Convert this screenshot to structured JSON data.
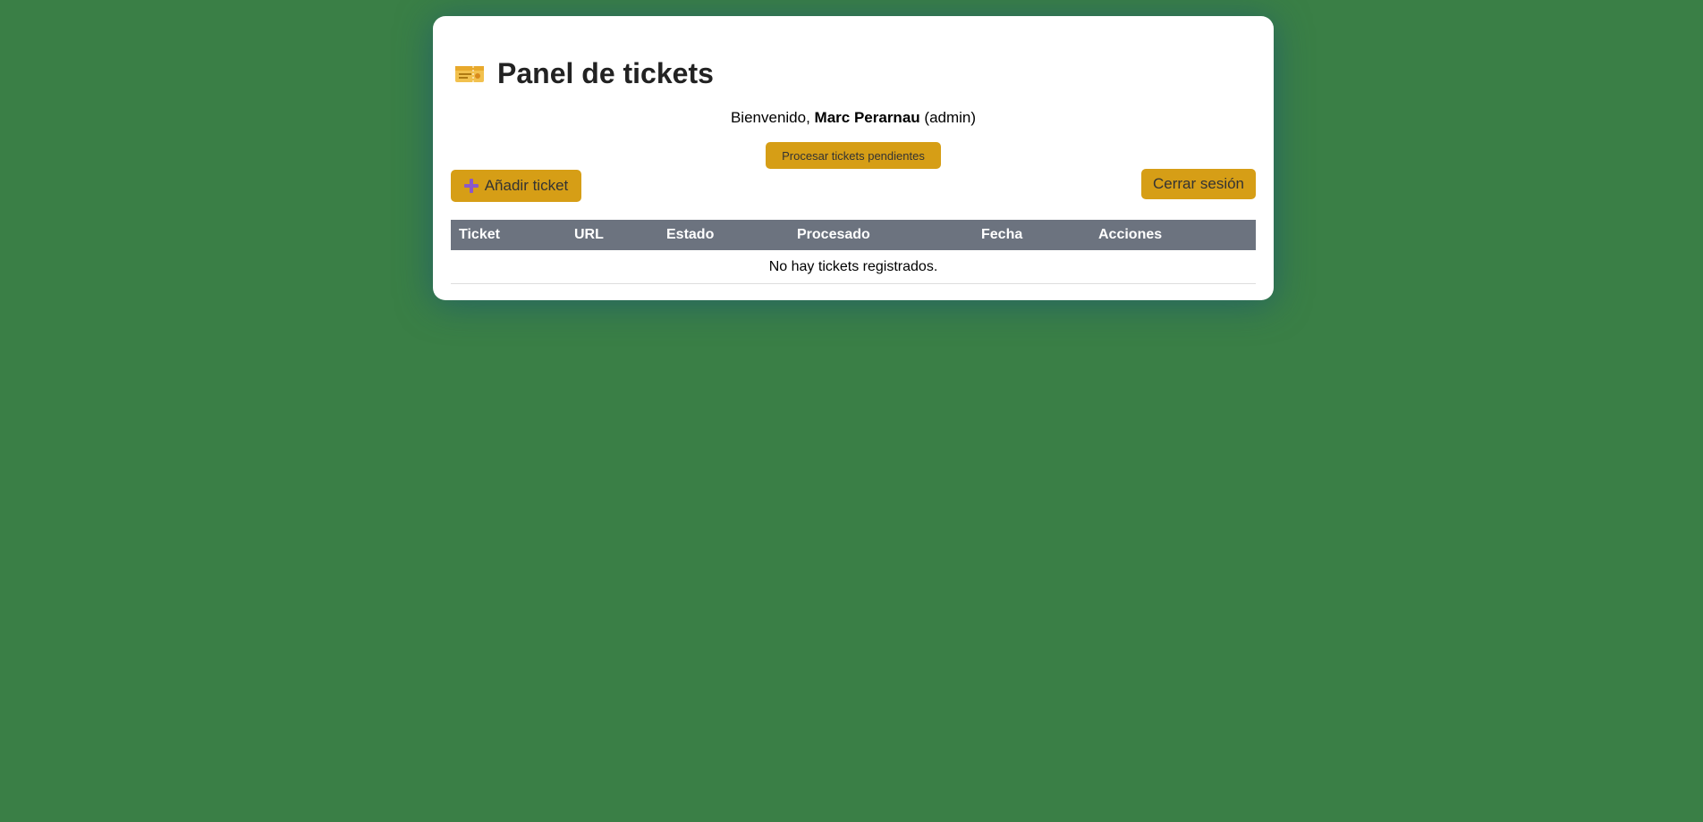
{
  "header": {
    "title": "Panel de tickets",
    "icon": "ticket-icon"
  },
  "welcome": {
    "prefix": "Bienvenido,",
    "user_name": "Marc Perarnau",
    "role": "(admin)"
  },
  "actions": {
    "process_label": "Procesar tickets pendientes",
    "add_label": "Añadir ticket",
    "add_icon": "plus-icon",
    "logout_label": "Cerrar sesión"
  },
  "table": {
    "columns": [
      "Ticket",
      "URL",
      "Estado",
      "Procesado",
      "Fecha",
      "Acciones"
    ],
    "empty_message": "No hay tickets registrados."
  },
  "colors": {
    "background": "#3a7f46",
    "accent": "#d69e16",
    "table_header": "#6c737f"
  }
}
